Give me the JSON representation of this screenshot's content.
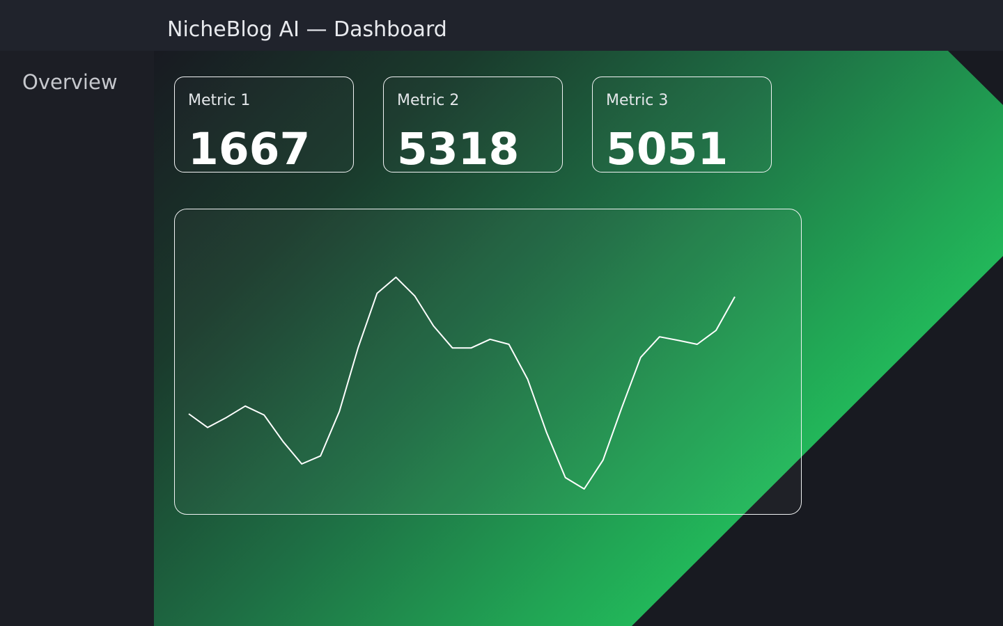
{
  "header": {
    "title": "NicheBlog AI — Dashboard"
  },
  "sidebar": {
    "items": [
      {
        "label": "Overview"
      }
    ]
  },
  "metrics": [
    {
      "label": "Metric 1",
      "value": "1667"
    },
    {
      "label": "Metric 2",
      "value": "5318"
    },
    {
      "label": "Metric 3",
      "value": "5051"
    }
  ],
  "colors": {
    "background": "#1b1d24",
    "topbar": "#20232c",
    "accent": "#22c55e",
    "line": "#ffffff"
  },
  "chart_data": {
    "type": "line",
    "title": "",
    "xlabel": "",
    "ylabel": "",
    "grid": false,
    "legend": "none",
    "x": [
      1,
      2,
      3,
      4,
      5,
      6,
      7,
      8,
      9,
      10,
      11,
      12,
      13,
      14,
      15,
      16,
      17,
      18,
      19,
      20,
      21,
      22,
      23,
      24,
      25,
      26,
      27,
      28,
      29,
      30
    ],
    "values": [
      31.5,
      26.6,
      30.2,
      34.3,
      31.1,
      21.6,
      13.5,
      16.4,
      32.4,
      55.4,
      74.8,
      80.6,
      73.9,
      63.1,
      55.2,
      55.2,
      58.3,
      56.5,
      43.9,
      24.8,
      8.6,
      4.5,
      14.9,
      33.8,
      51.8,
      59.2,
      57.9,
      56.5,
      61.5,
      73.6
    ],
    "ylim": [
      0,
      100
    ]
  }
}
